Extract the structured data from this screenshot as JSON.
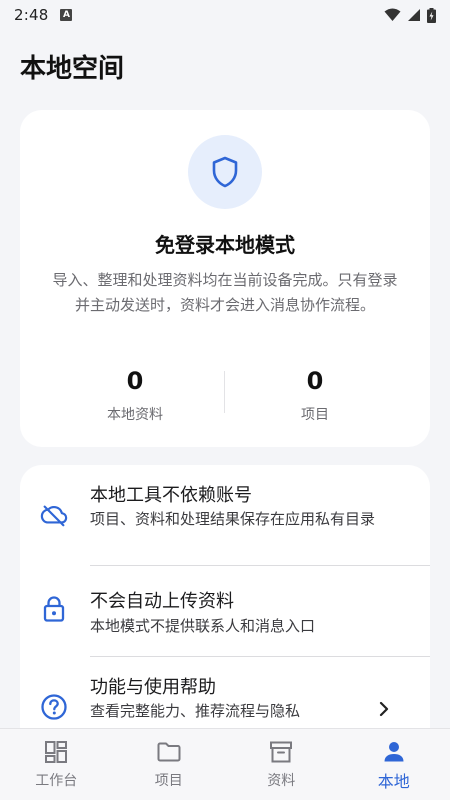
{
  "status_bar": {
    "time": "2:48",
    "badge": "A"
  },
  "page": {
    "title": "本地空间"
  },
  "hero": {
    "title": "免登录本地模式",
    "description": "导入、整理和处理资料均在当前设备完成。只有登录并主动发送时，资料才会进入消息协作流程。",
    "stats": [
      {
        "value": "0",
        "label": "本地资料"
      },
      {
        "value": "0",
        "label": "项目"
      }
    ]
  },
  "info_items": [
    {
      "icon": "cloud-off-icon",
      "title": "本地工具不依赖账号",
      "subtitle": "项目、资料和处理结果保存在应用私有目录"
    },
    {
      "icon": "lock-icon",
      "title": "不会自动上传资料",
      "subtitle": "本地模式不提供联系人和消息入口"
    },
    {
      "icon": "help-circle-icon",
      "title": "功能与使用帮助",
      "subtitle": "查看完整能力、推荐流程与隐私"
    }
  ],
  "bottom_nav": [
    {
      "icon": "dashboard-icon",
      "label": "工作台",
      "active": false
    },
    {
      "icon": "folder-icon",
      "label": "项目",
      "active": false
    },
    {
      "icon": "archive-icon",
      "label": "资料",
      "active": false
    },
    {
      "icon": "person-icon",
      "label": "本地",
      "active": true
    }
  ],
  "colors": {
    "accent": "#2f66d6",
    "background": "#f4f5f8",
    "card": "#ffffff"
  }
}
